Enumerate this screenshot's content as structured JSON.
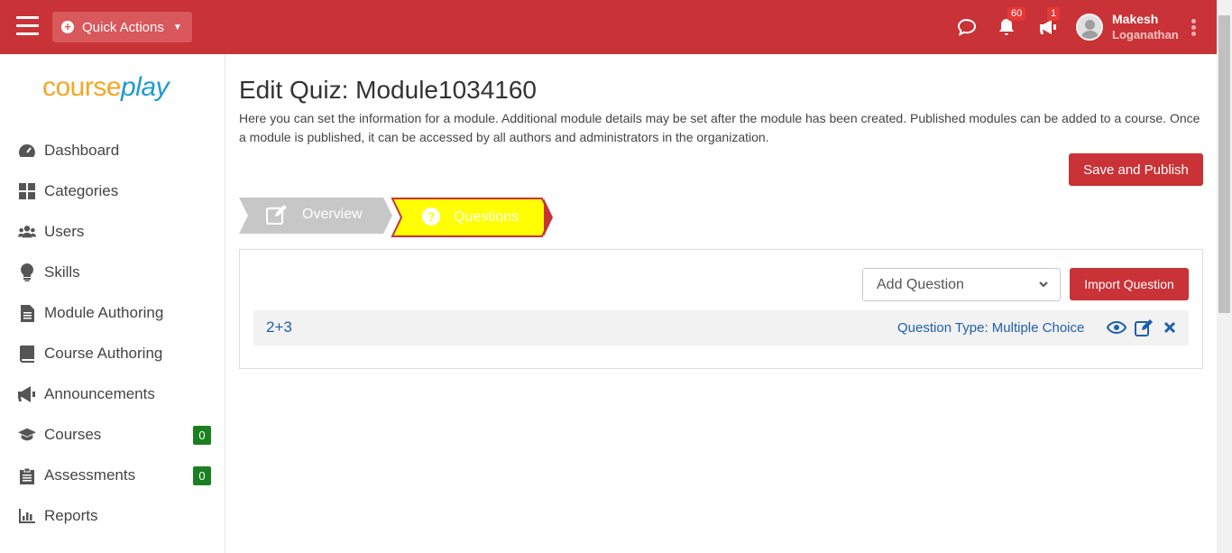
{
  "topbar": {
    "quick_actions_label": "Quick Actions",
    "notifications_count": "60",
    "announcements_count": "1",
    "user_first_name": "Makesh",
    "user_last_name": "Loganathan",
    "bg_color": "#c93236"
  },
  "sidebar": {
    "logo": {
      "course": "course",
      "play": "play"
    },
    "items": [
      {
        "label": "Dashboard",
        "icon": "dashboard-icon"
      },
      {
        "label": "Categories",
        "icon": "grid-icon"
      },
      {
        "label": "Users",
        "icon": "users-icon"
      },
      {
        "label": "Skills",
        "icon": "lightbulb-icon"
      },
      {
        "label": "Module Authoring",
        "icon": "file-icon"
      },
      {
        "label": "Course Authoring",
        "icon": "book-icon"
      },
      {
        "label": "Announcements",
        "icon": "megaphone-icon"
      },
      {
        "label": "Courses",
        "icon": "graduation-cap-icon",
        "count": "0"
      },
      {
        "label": "Assessments",
        "icon": "clipboard-icon",
        "count": "0"
      },
      {
        "label": "Reports",
        "icon": "bar-chart-icon"
      }
    ]
  },
  "main": {
    "title": "Edit Quiz: Module1034160",
    "description": "Here you can set the information for a module. Additional module details may be set after the module has been created. Published modules can be added to a course. Once a module is published, it can be accessed by all authors and administrators in the organization.",
    "save_publish_label": "Save and Publish",
    "steps": [
      {
        "label": "Overview",
        "state": "inactive"
      },
      {
        "label": "Questions",
        "state": "active"
      }
    ],
    "add_question_placeholder": "Add Question",
    "import_question_label": "Import Question",
    "questions": [
      {
        "text": "2+3",
        "type_label": "Question Type: Multiple Choice"
      }
    ]
  }
}
